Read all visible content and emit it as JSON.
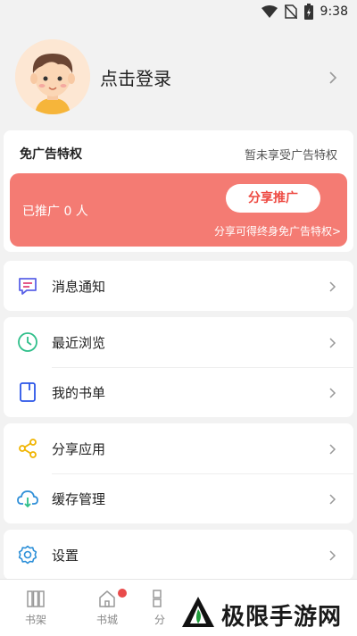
{
  "status_bar": {
    "time": "9:38"
  },
  "profile": {
    "login_text": "点击登录"
  },
  "ad_card": {
    "title": "免广告特权",
    "status": "暂未享受广告特权",
    "promoted_count": "已推广 0 人",
    "share_button": "分享推广",
    "hint": "分享可得终身免广告特权>"
  },
  "menu": {
    "messages": "消息通知",
    "recent": "最近浏览",
    "booklist": "我的书单",
    "share_app": "分享应用",
    "cache": "缓存管理",
    "settings": "设置"
  },
  "tabbar": {
    "shelf": "书架",
    "store": "书城",
    "category": "分"
  },
  "watermark": {
    "text": "极限手游网"
  },
  "colors": {
    "accent": "#f47b73",
    "message_icon": "#5b63e8",
    "recent_icon": "#2fbf8a",
    "booklist_icon": "#2b55e8",
    "share_icon": "#f0b400",
    "cache_icon": "#2f8fd8",
    "settings_icon": "#2b8fd8",
    "badge": "#e94b4b"
  }
}
